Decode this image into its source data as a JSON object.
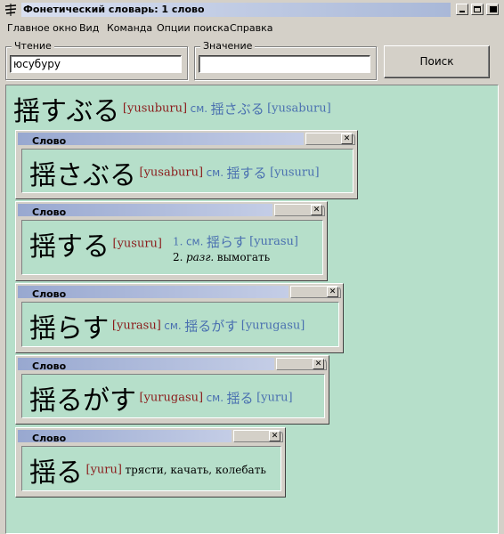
{
  "window": {
    "title": "Фонетический словарь: 1 слово",
    "app_icon": "dictionary-icon",
    "controls": [
      "minimize-icon",
      "maximize-icon",
      "close-icon"
    ]
  },
  "menu": [
    "Главное окно",
    "Вид",
    "Команда",
    "Опции поиска",
    "Справка"
  ],
  "search": {
    "reading_label": "Чтение",
    "reading_value": "юсубуру",
    "meaning_label": "Значение",
    "meaning_value": "",
    "button_label": "Поиск"
  },
  "headword": {
    "kanji": "揺すぶる",
    "reading": "[yusuburu]",
    "see": "см.",
    "ref_kanji": "揺さぶる",
    "ref_reading": "[yusaburu]"
  },
  "word_windows": [
    {
      "title": "Слово",
      "kanji": "揺さぶる",
      "reading": "[yusaburu]",
      "see": "см.",
      "ref_kanji": "揺する",
      "ref_reading": "[yusuru]"
    },
    {
      "title": "Слово",
      "kanji": "揺する",
      "reading": "[yusuru]",
      "sense1_num": "1.",
      "sense1_see": "см.",
      "sense1_ref_kanji": "揺らす",
      "sense1_ref_reading": "[yurasu]",
      "sense2_num": "2.",
      "sense2_tag": "разг.",
      "sense2_text": "вымогать"
    },
    {
      "title": "Слово",
      "kanji": "揺らす",
      "reading": "[yurasu]",
      "see": "см.",
      "ref_kanji": "揺るがす",
      "ref_reading": "[yurugasu]"
    },
    {
      "title": "Слово",
      "kanji": "揺るがす",
      "reading": "[yurugasu]",
      "see": "см.",
      "ref_kanji": "揺る",
      "ref_reading": "[yuru]"
    },
    {
      "title": "Слово",
      "kanji": "揺る",
      "reading": "[yuru]",
      "gloss": "трясти, качать, колебать"
    }
  ],
  "colors": {
    "panel_bg": "#b6dfca",
    "reading": "#8b1a1a",
    "reference": "#4a70b0",
    "chrome": "#d4d0c8"
  }
}
